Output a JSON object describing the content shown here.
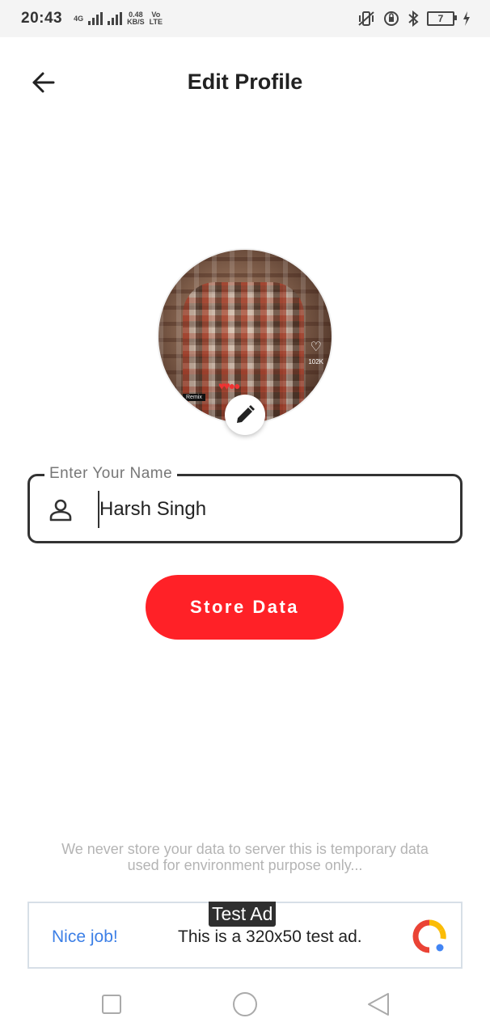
{
  "status_bar": {
    "time": "20:43",
    "network_type": "4G",
    "speed_value": "0.48",
    "speed_unit": "KB/S",
    "carrier_top": "Vo",
    "carrier_bottom": "LTE",
    "battery_level": "7"
  },
  "header": {
    "title": "Edit Profile"
  },
  "avatar": {
    "overlay_count": "102K",
    "overlay_tag": "Remix"
  },
  "name_field": {
    "label": "Enter Your Name",
    "value": "Harsh Singh"
  },
  "store_button": {
    "label": "Store Data"
  },
  "disclaimer": {
    "line1": "We never store your data to server this is temporary data",
    "line2": "used for environment purpose only..."
  },
  "ad": {
    "badge": "Test Ad",
    "headline": "Nice job!",
    "body": "This is a 320x50 test ad."
  },
  "colors": {
    "accent": "#ff2127",
    "ad_link": "#3c7fe6",
    "disclaimer_text": "#b4b4b4",
    "field_border": "#333333"
  },
  "icons": {
    "back": "arrow-left-icon",
    "edit": "pencil-icon",
    "person": "person-icon",
    "ad_logo": "google-ads-icon",
    "nav_recents": "square-icon",
    "nav_home": "circle-icon",
    "nav_back": "triangle-icon"
  }
}
